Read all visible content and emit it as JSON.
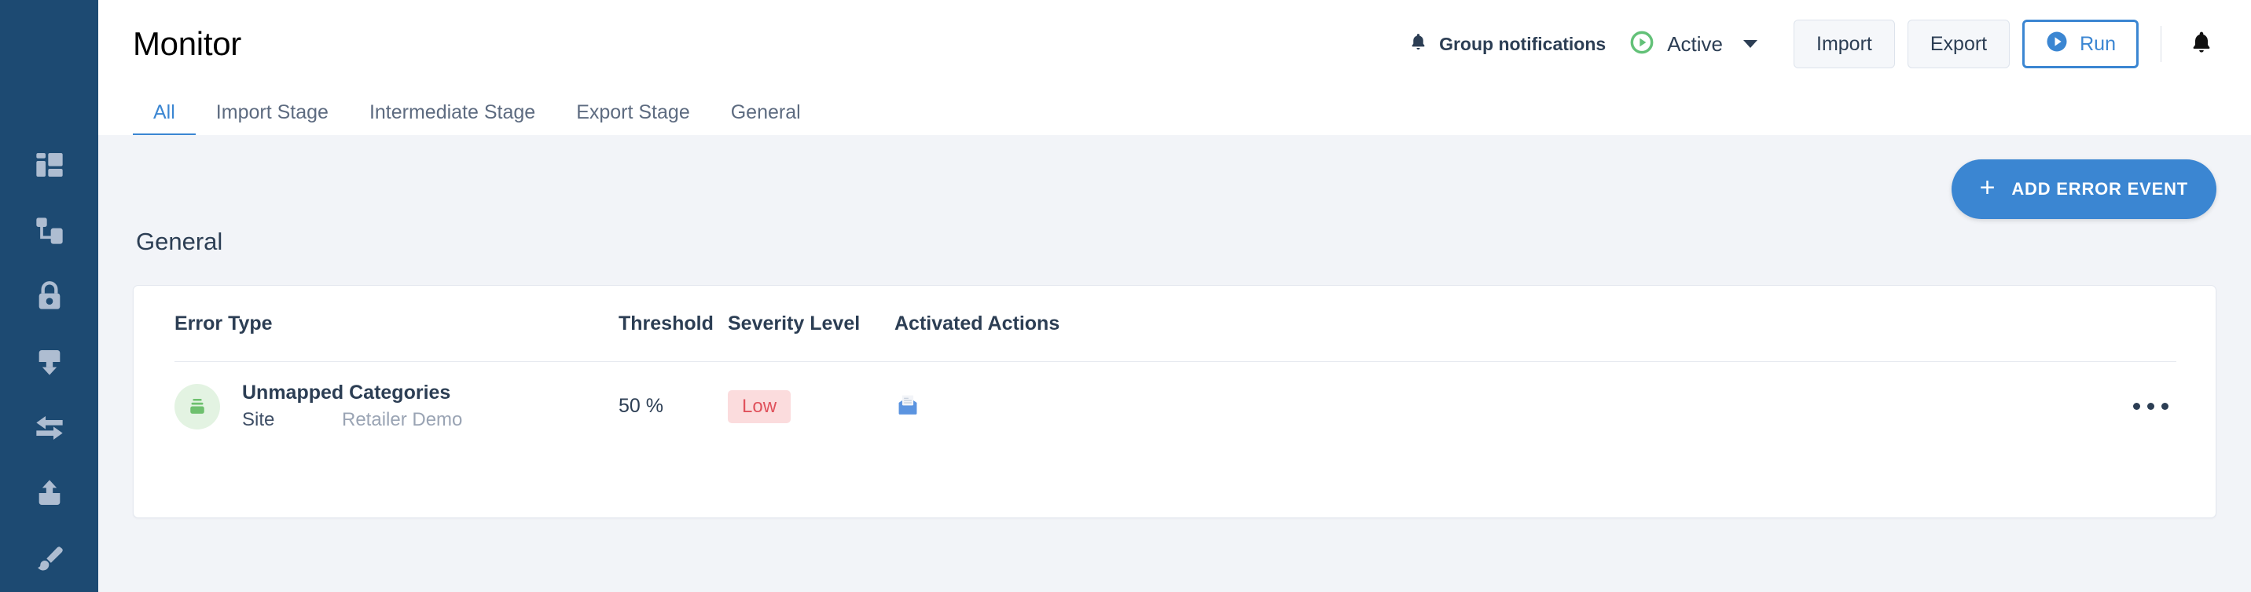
{
  "sidebar": {
    "items": [
      {
        "name": "dashboard-icon",
        "label": "Dashboard"
      },
      {
        "name": "hierarchy-icon",
        "label": "Flows"
      },
      {
        "name": "lock-icon",
        "label": "Security"
      },
      {
        "name": "import-icon",
        "label": "Import"
      },
      {
        "name": "sync-icon",
        "label": "Transfer"
      },
      {
        "name": "export-icon",
        "label": "Export"
      },
      {
        "name": "brush-icon",
        "label": "Design"
      }
    ]
  },
  "header": {
    "title": "Monitor",
    "group_notifications_label": "Group notifications",
    "group_notifications_icon": "bell-icon",
    "status_label": "Active",
    "status_icon": "play-circle-icon",
    "status_color": "#63c178",
    "import_label": "Import",
    "export_label": "Export",
    "run_label": "Run",
    "run_icon": "play-circle-icon",
    "run_color": "#3b86d2",
    "bell_icon": "bell-icon"
  },
  "tabs": [
    {
      "label": "All",
      "active": true
    },
    {
      "label": "Import Stage",
      "active": false
    },
    {
      "label": "Intermediate Stage",
      "active": false
    },
    {
      "label": "Export Stage",
      "active": false
    },
    {
      "label": "General",
      "active": false
    }
  ],
  "content": {
    "add_button_label": "ADD ERROR EVENT",
    "add_button_icon": "plus-icon",
    "section_title": "General",
    "table": {
      "columns": [
        "Error Type",
        "Threshold",
        "Severity Level",
        "Activated Actions"
      ],
      "rows": [
        {
          "icon": "archive-box-icon",
          "name": "Unmapped Categories",
          "sub_key": "Site",
          "sub_value": "Retailer Demo",
          "threshold": "50 %",
          "severity": "Low",
          "severity_color": "#e0525c",
          "severity_bg": "#fbdcdd",
          "actions": [
            "email-icon"
          ],
          "menu_icon": "kebab-menu-icon"
        }
      ]
    }
  }
}
